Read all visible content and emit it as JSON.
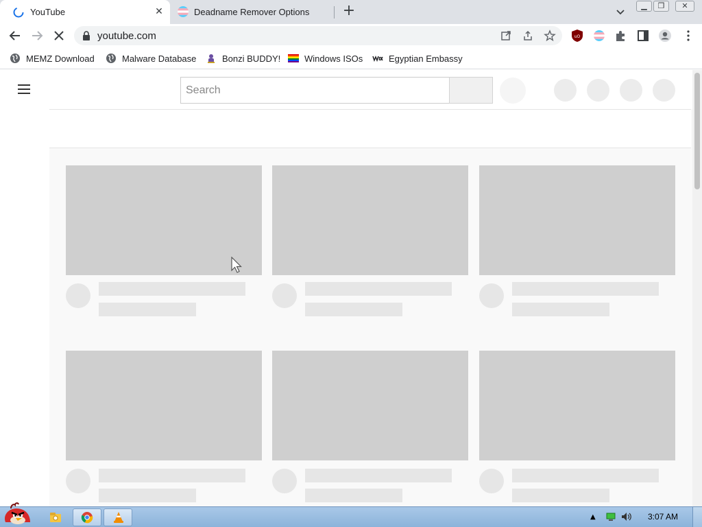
{
  "browser": {
    "tabs": [
      {
        "title": "YouTube",
        "active": true
      },
      {
        "title": "Deadname Remover Options",
        "active": false
      }
    ],
    "address": "youtube.com",
    "bookmarks": [
      {
        "label": "MEMZ Download",
        "icon": "globe-icon"
      },
      {
        "label": "Malware Database",
        "icon": "globe-icon"
      },
      {
        "label": "Bonzi BUDDY!",
        "icon": "bonzi-icon"
      },
      {
        "label": "Windows ISOs",
        "icon": "rainbow-flag-icon"
      },
      {
        "label": "Egyptian Embassy",
        "icon": "wix-icon"
      }
    ]
  },
  "youtube": {
    "search_placeholder": "Search"
  },
  "taskbar": {
    "clock": "3:07 AM"
  },
  "colors": {
    "tab_strip": "#dee1e6",
    "thumbnail_placeholder": "#cfcfcf",
    "text_placeholder": "#e6e6e6",
    "taskbar": "#9fc0e2"
  }
}
